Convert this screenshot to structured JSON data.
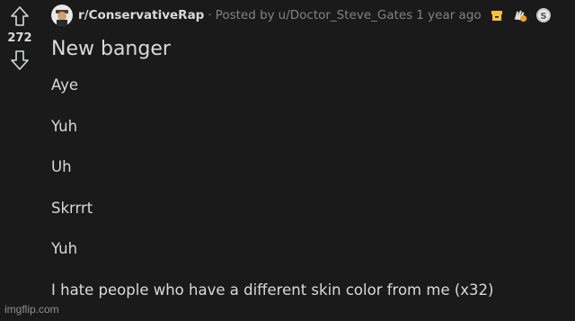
{
  "post": {
    "score": "272",
    "subreddit": "r/ConservativeRap",
    "separator": "·",
    "posted_by_prefix": "Posted by",
    "username": "u/Doctor_Steve_Gates",
    "timestamp": "1 year ago",
    "title": "New banger",
    "body_lines": [
      "Aye",
      "Yuh",
      "Uh",
      "Skrrrt",
      "Yuh",
      "I hate people who have a different skin color from me (x32)"
    ],
    "awards": [
      "archive-award-icon",
      "clapping-award-icon",
      "silver-award-icon"
    ]
  },
  "watermark": "imgflip.com",
  "colors": {
    "background": "#1a1a1b",
    "text": "#d7dadc",
    "muted": "#818384",
    "award_gold": "#f4c430"
  }
}
